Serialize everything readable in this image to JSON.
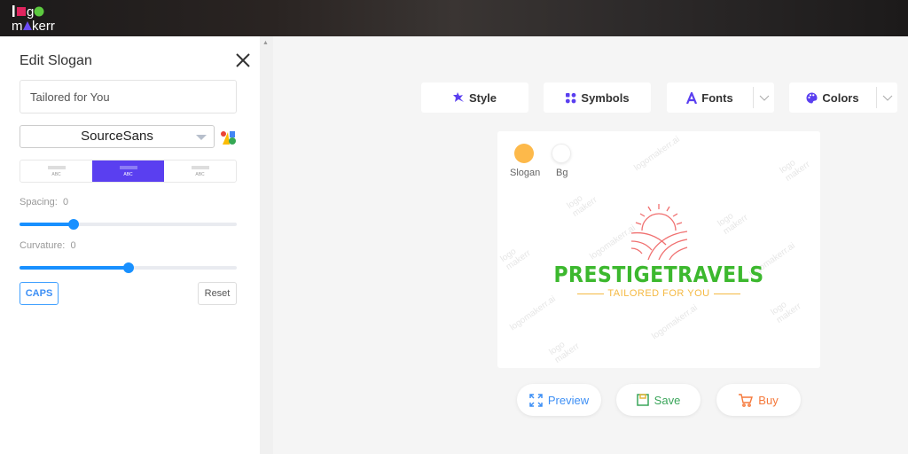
{
  "app": {
    "logo_text": "logomakerr"
  },
  "panel": {
    "title": "Edit Slogan",
    "slogan_value": "Tailored for You",
    "font": "SourceSans",
    "align_options": [
      "ABC",
      "ABC",
      "ABC"
    ],
    "align_selected": 1,
    "spacing": {
      "label": "Spacing:",
      "value": "0",
      "position_percent": 25
    },
    "curvature": {
      "label": "Curvature:",
      "value": "0",
      "position_percent": 50
    },
    "caps_label": "CAPS",
    "reset_label": "Reset"
  },
  "toolbar": {
    "style": "Style",
    "symbols": "Symbols",
    "fonts": "Fonts",
    "colors": "Colors"
  },
  "preview": {
    "swatches": [
      {
        "label": "Slogan",
        "color": "#fdb94a"
      },
      {
        "label": "Bg",
        "color": "#ffffff"
      }
    ],
    "brand_name": "PRESTIGETRAVELS",
    "slogan": "TAILORED FOR YOU",
    "watermark": "logomakerr.ai",
    "brand_color": "#3cb82e",
    "slogan_color": "#f5b942",
    "symbol_color": "#f07070"
  },
  "actions": {
    "preview": "Preview",
    "save": "Save",
    "buy": "Buy"
  },
  "colors": {
    "accent": "#5a3ff0",
    "slider": "#1890ff"
  }
}
